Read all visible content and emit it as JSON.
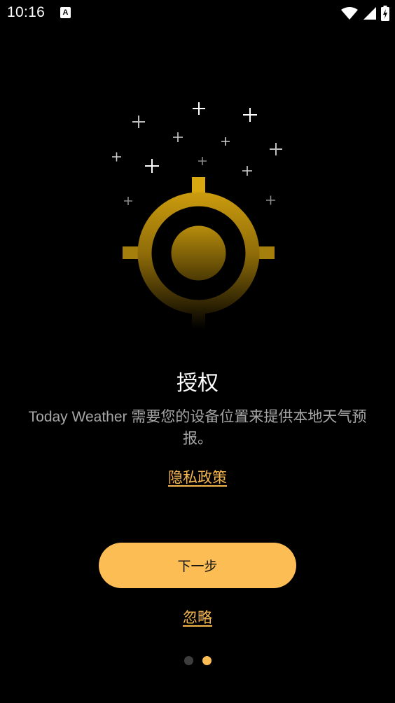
{
  "status_bar": {
    "time": "10:16",
    "notification_icon": "A",
    "icons": [
      "wifi-icon",
      "cell-signal-icon",
      "battery-charging-icon"
    ]
  },
  "illustration": {
    "icon": "location-crosshair-icon",
    "accent_color": "#d9a70f",
    "decoration": "sparkle-stars"
  },
  "onboarding": {
    "title": "授权",
    "description": "Today Weather 需要您的设备位置来提供本地天气预报。",
    "privacy_link": "隐私政策",
    "next_button": "下一步",
    "skip_link": "忽略"
  },
  "pager": {
    "total_pages": 2,
    "current_page": 2
  },
  "colors": {
    "background": "#000000",
    "primary": "#fdbd55",
    "link": "#f6b64e",
    "text_secondary": "#a6a6a6",
    "dot_inactive": "#3d3d3d"
  }
}
